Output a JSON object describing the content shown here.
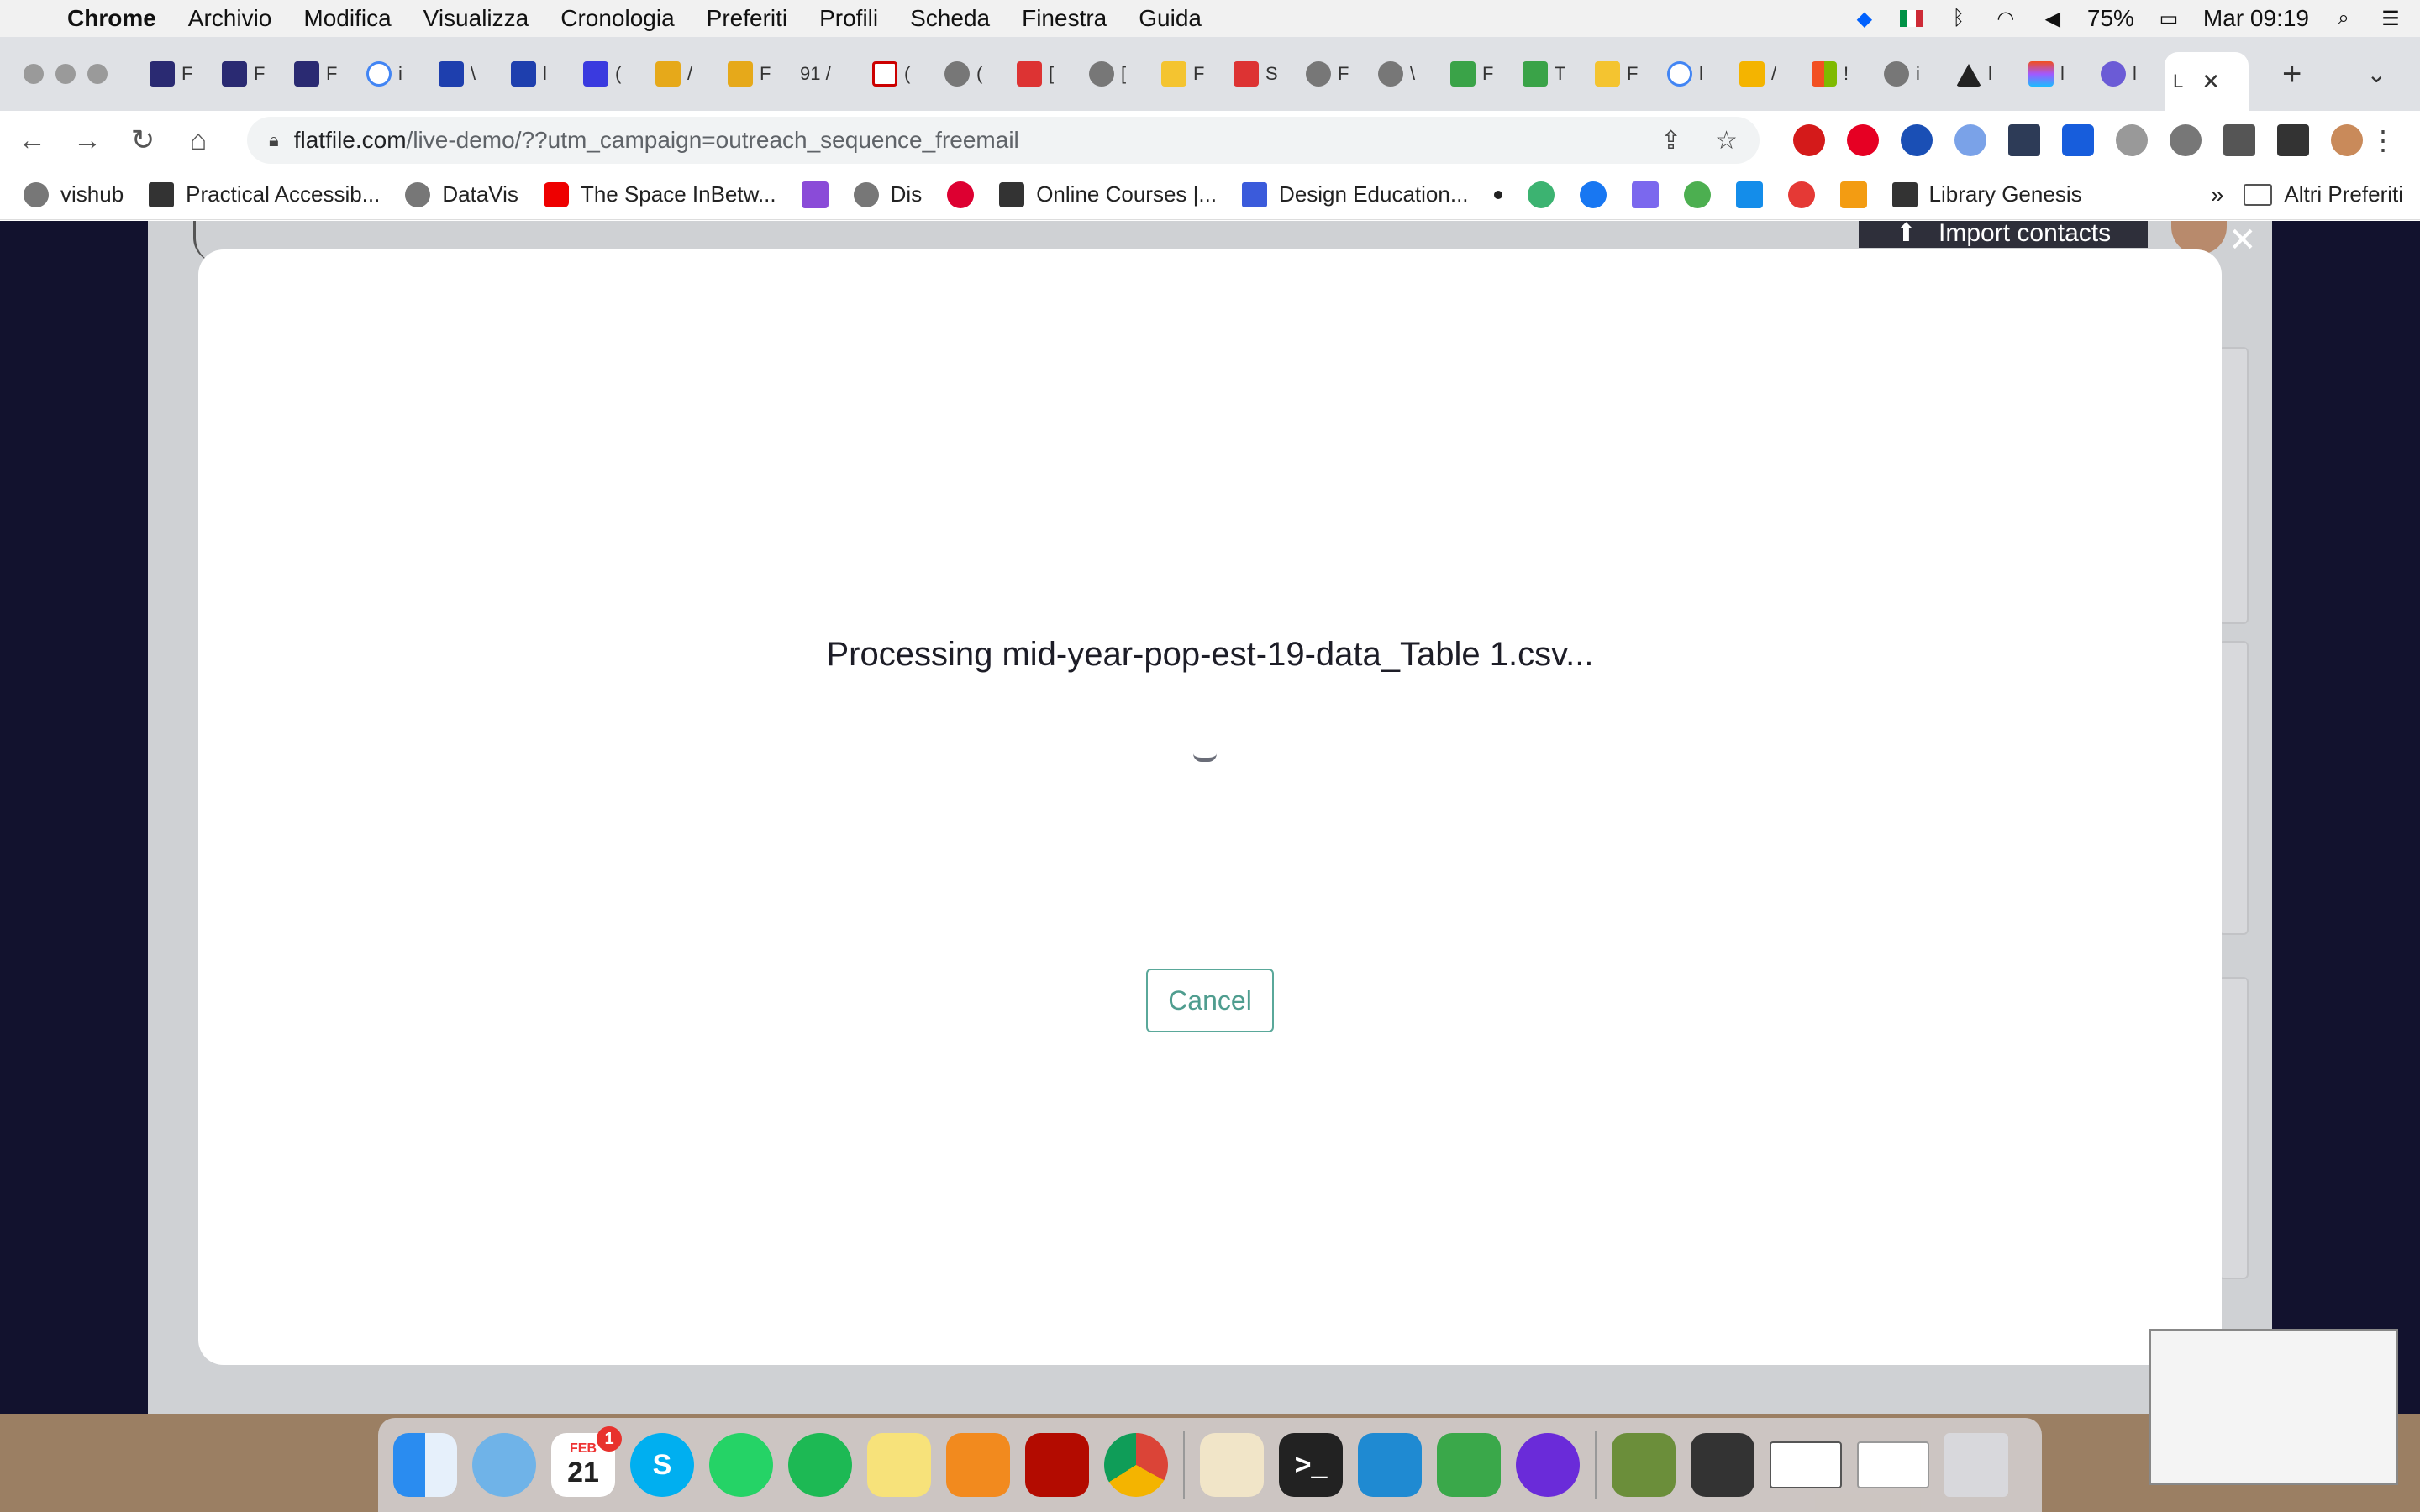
{
  "menubar": {
    "app_name": "Chrome",
    "items": [
      "Archivio",
      "Modifica",
      "Visualizza",
      "Cronologia",
      "Preferiti",
      "Profili",
      "Scheda",
      "Finestra",
      "Guida"
    ],
    "battery": "75%",
    "clock": "Mar 09:19"
  },
  "tabs": {
    "labels": [
      "F",
      "F",
      "F",
      "i",
      "\\",
      "l",
      "(",
      "/",
      "F",
      "91 /",
      "(",
      "(",
      "[",
      "[",
      "F",
      "S",
      "F",
      "\\",
      "F",
      "T",
      "F",
      "l",
      "/",
      "!",
      "i",
      "l",
      "l",
      "l",
      "L"
    ],
    "active_label": "L"
  },
  "address_bar": {
    "domain": "flatfile.com",
    "path": "/live-demo/??utm_campaign=outreach_sequence_freemail"
  },
  "bookmarks": {
    "items": [
      "vishub",
      "Practical Accessib...",
      "DataVis",
      "The Space InBetw...",
      "Dis",
      "Online Courses |...",
      "Design Education...",
      "Library Genesis"
    ],
    "overflow": "»",
    "other_folder": "Altri Preferiti"
  },
  "page": {
    "import_button": "Import contacts",
    "modal": {
      "processing_text": "Processing mid-year-pop-est-19-data_Table 1.csv...",
      "cancel_label": "Cancel"
    }
  },
  "dock": {
    "calendar_month": "FEB",
    "calendar_day": "21",
    "calendar_badge": "1"
  },
  "colors": {
    "page_background": "#12122e",
    "modal_background": "#ffffff",
    "accent_teal": "#4f9d8f"
  }
}
